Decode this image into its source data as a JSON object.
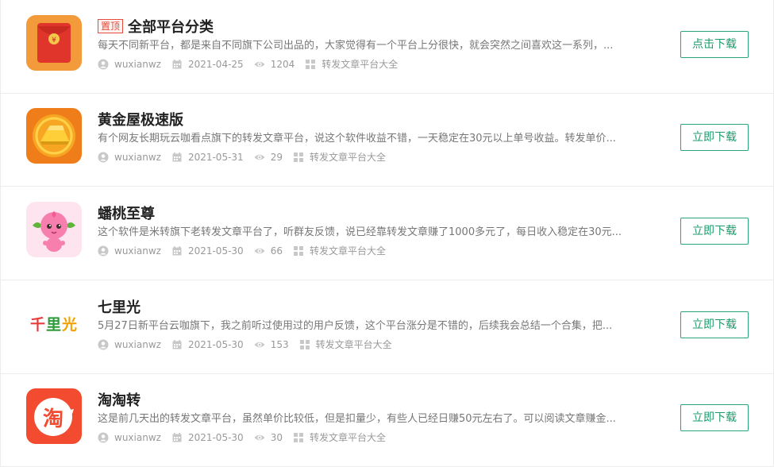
{
  "items": [
    {
      "logo": "red-envelope-logo",
      "pin_label": "置顶",
      "title": "全部平台分类",
      "desc": "每天不同新平台，都是来自不同旗下公司出品的，大家觉得有一个平台上分很快，就会突然之间喜欢这一系列，...",
      "author": "wuxianwz",
      "date": "2021-04-25",
      "views": "1204",
      "category": "转发文章平台大全",
      "button": "点击下载"
    },
    {
      "logo": "gold-bar-logo",
      "title": "黄金屋极速版",
      "desc": "有个网友长期玩云咖看点旗下的转发文章平台，说这个软件收益不错，一天稳定在30元以上单号收益。转发单价...",
      "author": "wuxianwz",
      "date": "2021-05-31",
      "views": "29",
      "category": "转发文章平台大全",
      "button": "立即下载"
    },
    {
      "logo": "peach-mascot-logo",
      "title": "蟠桃至尊",
      "desc": "这个软件是米转旗下老转发文章平台了，听群友反馈，说已经靠转发文章赚了1000多元了，每日收入稳定在30元...",
      "author": "wuxianwz",
      "date": "2021-05-30",
      "views": "66",
      "category": "转发文章平台大全",
      "button": "立即下载"
    },
    {
      "logo": "qiliguang-text-logo",
      "logo_text": "千里光",
      "title": "七里光",
      "desc": "5月27日新平台云咖旗下，我之前听过使用过的用户反馈，这个平台涨分是不错的，后续我会总结一个合集，把...",
      "author": "wuxianwz",
      "date": "2021-05-30",
      "views": "153",
      "category": "转发文章平台大全",
      "button": "立即下载"
    },
    {
      "logo": "taotaozhuan-logo",
      "logo_text": "淘",
      "title": "淘淘转",
      "desc": "这是前几天出的转发文章平台，虽然单价比较低，但是扣量少，有些人已经日赚50元左右了。可以阅读文章赚金...",
      "author": "wuxianwz",
      "date": "2021-05-30",
      "views": "30",
      "category": "转发文章平台大全",
      "button": "立即下载"
    }
  ],
  "icons": {
    "author": "user-icon",
    "date": "calendar-icon",
    "views": "eye-icon",
    "category": "grid-icon"
  },
  "colors": {
    "accent": "#1f9a6c",
    "pin": "#e64b3b",
    "meta": "#999999"
  }
}
